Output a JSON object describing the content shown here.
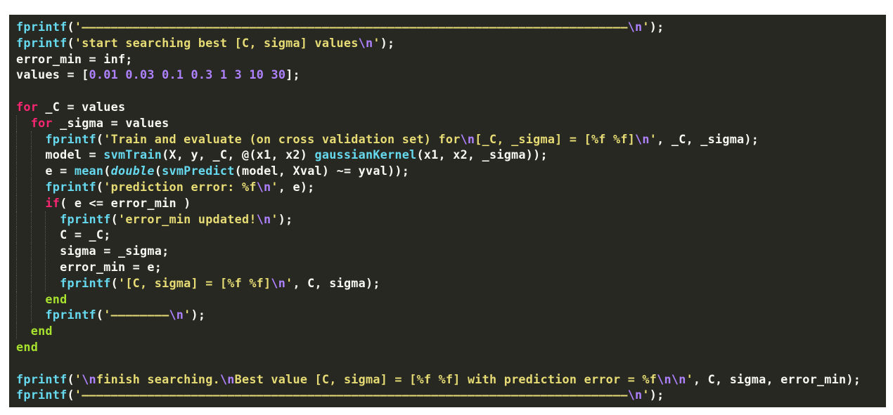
{
  "editor": {
    "background": "#272822",
    "colors": {
      "fn": "#66d9ef",
      "str": "#e6db74",
      "esc": "#ae81ff",
      "num": "#ae81ff",
      "kw": "#f92672",
      "end": "#a6e22e",
      "plain": "#f8f8f2"
    },
    "lines": [
      {
        "indent": 0,
        "tokens": [
          {
            "t": "fn",
            "v": "fprintf"
          },
          {
            "t": "plain",
            "v": "("
          },
          {
            "t": "str",
            "v": "'———————————————————————————————————————————————————————————————————————————"
          },
          {
            "t": "esc",
            "v": "\\n"
          },
          {
            "t": "str",
            "v": "'"
          },
          {
            "t": "plain",
            "v": ");"
          }
        ]
      },
      {
        "indent": 0,
        "tokens": [
          {
            "t": "fn",
            "v": "fprintf"
          },
          {
            "t": "plain",
            "v": "("
          },
          {
            "t": "str",
            "v": "'start searching best [C, sigma] values"
          },
          {
            "t": "esc",
            "v": "\\n"
          },
          {
            "t": "str",
            "v": "'"
          },
          {
            "t": "plain",
            "v": ");"
          }
        ]
      },
      {
        "indent": 0,
        "tokens": [
          {
            "t": "plain",
            "v": "error_min = inf;"
          }
        ]
      },
      {
        "indent": 0,
        "tokens": [
          {
            "t": "plain",
            "v": "values = ["
          },
          {
            "t": "num",
            "v": "0.01"
          },
          {
            "t": "plain",
            "v": " "
          },
          {
            "t": "num",
            "v": "0.03"
          },
          {
            "t": "plain",
            "v": " "
          },
          {
            "t": "num",
            "v": "0.1"
          },
          {
            "t": "plain",
            "v": " "
          },
          {
            "t": "num",
            "v": "0.3"
          },
          {
            "t": "plain",
            "v": " "
          },
          {
            "t": "num",
            "v": "1"
          },
          {
            "t": "plain",
            "v": " "
          },
          {
            "t": "num",
            "v": "3"
          },
          {
            "t": "plain",
            "v": " "
          },
          {
            "t": "num",
            "v": "10"
          },
          {
            "t": "plain",
            "v": " "
          },
          {
            "t": "num",
            "v": "30"
          },
          {
            "t": "plain",
            "v": "];"
          }
        ]
      },
      {
        "indent": 0,
        "tokens": []
      },
      {
        "indent": 0,
        "tokens": [
          {
            "t": "kw",
            "v": "for"
          },
          {
            "t": "plain",
            "v": " _C = values"
          }
        ]
      },
      {
        "indent": 1,
        "tokens": [
          {
            "t": "kw",
            "v": "for"
          },
          {
            "t": "plain",
            "v": " _sigma = values"
          }
        ]
      },
      {
        "indent": 2,
        "tokens": [
          {
            "t": "fn",
            "v": "fprintf"
          },
          {
            "t": "plain",
            "v": "("
          },
          {
            "t": "str",
            "v": "'Train and evaluate (on cross validation set) for"
          },
          {
            "t": "esc",
            "v": "\\n"
          },
          {
            "t": "str",
            "v": "[_C, _sigma] = [%f %f]"
          },
          {
            "t": "esc",
            "v": "\\n"
          },
          {
            "t": "str",
            "v": "'"
          },
          {
            "t": "plain",
            "v": ", _C, _sigma);"
          }
        ]
      },
      {
        "indent": 2,
        "tokens": [
          {
            "t": "plain",
            "v": "model = "
          },
          {
            "t": "fn",
            "v": "svmTrain"
          },
          {
            "t": "plain",
            "v": "(X, y, _C, @(x1, x2) "
          },
          {
            "t": "fn",
            "v": "gaussianKernel"
          },
          {
            "t": "plain",
            "v": "(x1, x2, _sigma));"
          }
        ]
      },
      {
        "indent": 2,
        "tokens": [
          {
            "t": "plain",
            "v": "e = "
          },
          {
            "t": "fn",
            "v": "mean"
          },
          {
            "t": "plain",
            "v": "("
          },
          {
            "t": "ital",
            "v": "double"
          },
          {
            "t": "plain",
            "v": "("
          },
          {
            "t": "fn",
            "v": "svmPredict"
          },
          {
            "t": "plain",
            "v": "(model, Xval) ~= yval));"
          }
        ]
      },
      {
        "indent": 2,
        "tokens": [
          {
            "t": "fn",
            "v": "fprintf"
          },
          {
            "t": "plain",
            "v": "("
          },
          {
            "t": "str",
            "v": "'prediction error: %f"
          },
          {
            "t": "esc",
            "v": "\\n"
          },
          {
            "t": "str",
            "v": "'"
          },
          {
            "t": "plain",
            "v": ", e);"
          }
        ]
      },
      {
        "indent": 2,
        "tokens": [
          {
            "t": "kw",
            "v": "if"
          },
          {
            "t": "plain",
            "v": "( e <= error_min )"
          }
        ]
      },
      {
        "indent": 3,
        "tokens": [
          {
            "t": "fn",
            "v": "fprintf"
          },
          {
            "t": "plain",
            "v": "("
          },
          {
            "t": "str",
            "v": "'error_min updated!"
          },
          {
            "t": "esc",
            "v": "\\n"
          },
          {
            "t": "str",
            "v": "'"
          },
          {
            "t": "plain",
            "v": ");"
          }
        ]
      },
      {
        "indent": 3,
        "tokens": [
          {
            "t": "plain",
            "v": "C = _C;"
          }
        ]
      },
      {
        "indent": 3,
        "tokens": [
          {
            "t": "plain",
            "v": "sigma = _sigma;"
          }
        ]
      },
      {
        "indent": 3,
        "tokens": [
          {
            "t": "plain",
            "v": "error_min = e;"
          }
        ]
      },
      {
        "indent": 3,
        "tokens": [
          {
            "t": "fn",
            "v": "fprintf"
          },
          {
            "t": "plain",
            "v": "("
          },
          {
            "t": "str",
            "v": "'[C, sigma] = [%f %f]"
          },
          {
            "t": "esc",
            "v": "\\n"
          },
          {
            "t": "str",
            "v": "'"
          },
          {
            "t": "plain",
            "v": ", C, sigma);"
          }
        ]
      },
      {
        "indent": 2,
        "tokens": [
          {
            "t": "end",
            "v": "end"
          }
        ]
      },
      {
        "indent": 2,
        "tokens": [
          {
            "t": "fn",
            "v": "fprintf"
          },
          {
            "t": "plain",
            "v": "("
          },
          {
            "t": "str",
            "v": "'————————"
          },
          {
            "t": "esc",
            "v": "\\n"
          },
          {
            "t": "str",
            "v": "'"
          },
          {
            "t": "plain",
            "v": ");"
          }
        ]
      },
      {
        "indent": 1,
        "tokens": [
          {
            "t": "end",
            "v": "end"
          }
        ]
      },
      {
        "indent": 0,
        "tokens": [
          {
            "t": "end",
            "v": "end"
          }
        ]
      },
      {
        "indent": 0,
        "tokens": []
      },
      {
        "indent": 0,
        "tokens": [
          {
            "t": "fn",
            "v": "fprintf"
          },
          {
            "t": "plain",
            "v": "("
          },
          {
            "t": "str",
            "v": "'"
          },
          {
            "t": "esc",
            "v": "\\n"
          },
          {
            "t": "str",
            "v": "finish searching."
          },
          {
            "t": "esc",
            "v": "\\n"
          },
          {
            "t": "str",
            "v": "Best value [C, sigma] = [%f %f] with prediction error = %f"
          },
          {
            "t": "esc",
            "v": "\\n\\n"
          },
          {
            "t": "str",
            "v": "'"
          },
          {
            "t": "plain",
            "v": ", C, sigma, error_min);"
          }
        ]
      },
      {
        "indent": 0,
        "tokens": [
          {
            "t": "fn",
            "v": "fprintf"
          },
          {
            "t": "plain",
            "v": "("
          },
          {
            "t": "str",
            "v": "'———————————————————————————————————————————————————————————————————————————"
          },
          {
            "t": "esc",
            "v": "\\n"
          },
          {
            "t": "str",
            "v": "'"
          },
          {
            "t": "plain",
            "v": ");"
          }
        ]
      }
    ]
  }
}
